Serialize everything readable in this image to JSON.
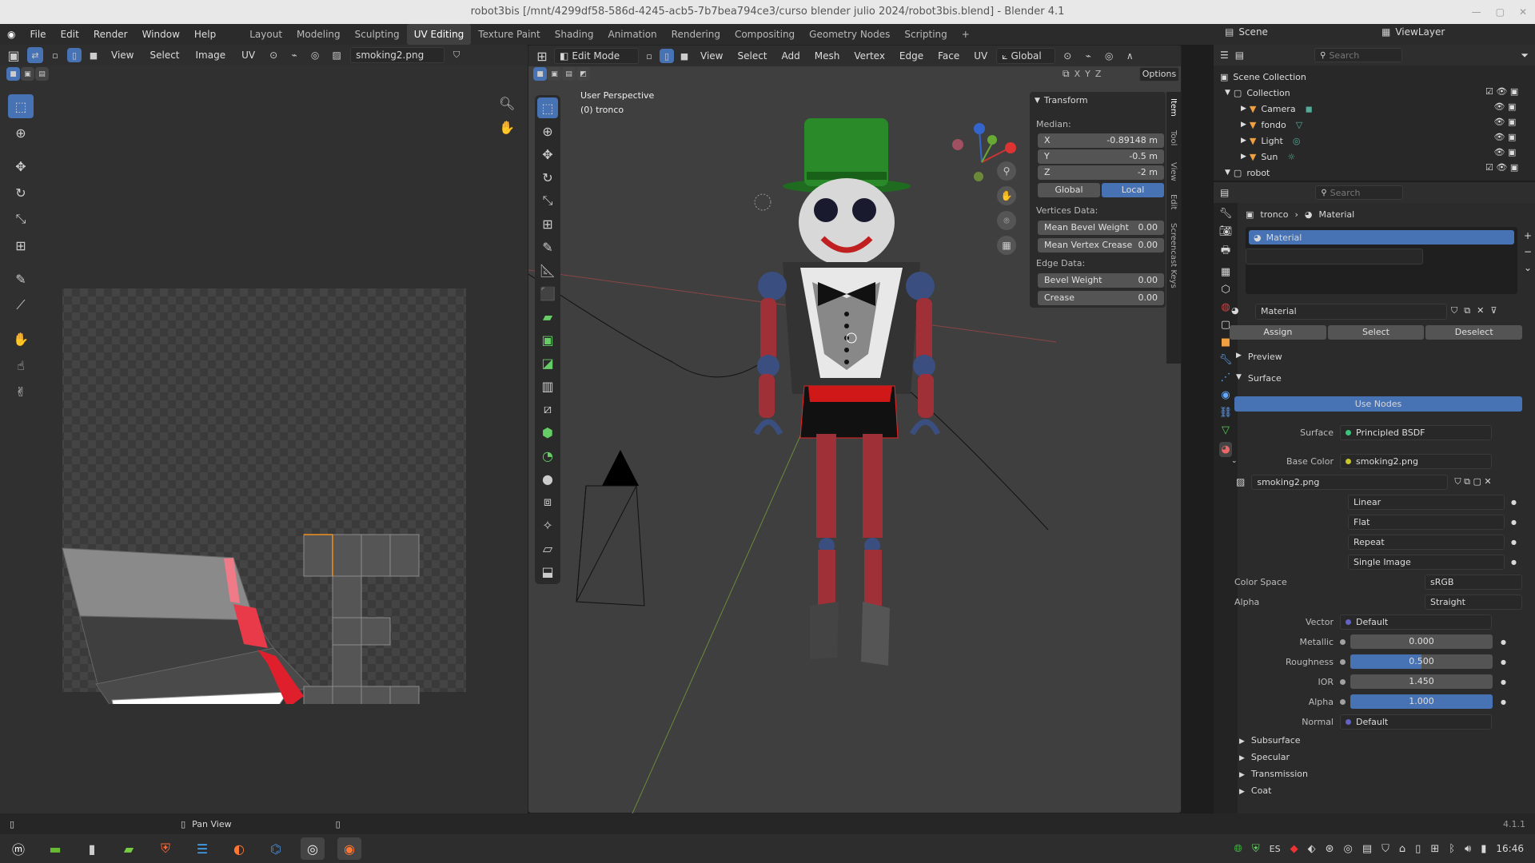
{
  "window": {
    "title": "robot3bis [/mnt/4299df58-586d-4245-acb5-7b7bea794ce3/curso blender julio 2024/robot3bis.blend] - Blender 4.1"
  },
  "menus": [
    "File",
    "Edit",
    "Render",
    "Window",
    "Help"
  ],
  "workspaces": [
    "Layout",
    "Modeling",
    "Sculpting",
    "UV Editing",
    "Texture Paint",
    "Shading",
    "Animation",
    "Rendering",
    "Compositing",
    "Geometry Nodes",
    "Scripting",
    "+"
  ],
  "active_workspace": "UV Editing",
  "scene": {
    "scene_name": "Scene",
    "view_layer": "ViewLayer"
  },
  "uv_editor": {
    "menus": [
      "View",
      "Select",
      "Image",
      "UV"
    ],
    "image_name": "smoking2.png"
  },
  "viewport": {
    "mode": "Edit Mode",
    "menus": [
      "View",
      "Select",
      "Add",
      "Mesh",
      "Vertex",
      "Edge",
      "Face",
      "UV"
    ],
    "orientation": "Global",
    "axes": [
      "X",
      "Y",
      "Z"
    ],
    "options_label": "Options",
    "overlay_line1": "User Perspective",
    "overlay_line2": "(0) tronco",
    "side_tabs": [
      "Item",
      "Tool",
      "View",
      "Edit",
      "Screencast Keys"
    ]
  },
  "transform_panel": {
    "title": "Transform",
    "median_label": "Median:",
    "x_label": "X",
    "x_value": "-0.89148 m",
    "y_label": "Y",
    "y_value": "-0.5 m",
    "z_label": "Z",
    "z_value": "-2 m",
    "global_label": "Global",
    "local_label": "Local",
    "vertices_data": "Vertices Data:",
    "mean_bevel_label": "Mean Bevel Weight",
    "mean_bevel_value": "0.00",
    "mean_crease_label": "Mean Vertex Crease",
    "mean_crease_value": "0.00",
    "edge_data": "Edge Data:",
    "bevel_label": "Bevel Weight",
    "bevel_value": "0.00",
    "crease_label": "Crease",
    "crease_value": "0.00"
  },
  "outliner": {
    "search_placeholder": "Search",
    "scene_collection": "Scene Collection",
    "items": [
      {
        "label": "Collection",
        "level": 1
      },
      {
        "label": "Camera",
        "level": 2
      },
      {
        "label": "fondo",
        "level": 2
      },
      {
        "label": "Light",
        "level": 2
      },
      {
        "label": "Sun",
        "level": 2
      },
      {
        "label": "robot",
        "level": 1
      }
    ]
  },
  "properties": {
    "search_placeholder": "Search",
    "breadcrumb_object": "tronco",
    "breadcrumb_tab": "Material",
    "slot_name": "Material",
    "material_name": "Material",
    "assign": "Assign",
    "select": "Select",
    "deselect": "Deselect",
    "preview": "Preview",
    "surface_section": "Surface",
    "use_nodes": "Use Nodes",
    "surface_label": "Surface",
    "surface_value": "Principled BSDF",
    "base_color_label": "Base Color",
    "base_color_value": "smoking2.png",
    "image_name": "smoking2.png",
    "interpolation": "Linear",
    "projection": "Flat",
    "extension": "Repeat",
    "source": "Single Image",
    "color_space_label": "Color Space",
    "color_space_value": "sRGB",
    "alpha_mode_label": "Alpha",
    "alpha_mode_value": "Straight",
    "vector_label": "Vector",
    "vector_value": "Default",
    "metallic_label": "Metallic",
    "metallic_value": "0.000",
    "roughness_label": "Roughness",
    "roughness_value": "0.500",
    "roughness_fraction": 0.5,
    "ior_label": "IOR",
    "ior_value": "1.450",
    "alpha_label": "Alpha",
    "alpha_value": "1.000",
    "alpha_fraction": 1.0,
    "normal_label": "Normal",
    "normal_value": "Default",
    "subsections": [
      "Subsurface",
      "Specular",
      "Transmission",
      "Coat"
    ]
  },
  "statusbar": {
    "action": "Pan View",
    "version": "4.1.1"
  },
  "taskbar": {
    "keyboard_layout": "ES",
    "clock": "16:46"
  },
  "colors": {
    "accent": "#4772b3",
    "bg": "#1d1d1d",
    "panel": "#2e2e2e",
    "selected_edge": "#ff2a2a"
  }
}
